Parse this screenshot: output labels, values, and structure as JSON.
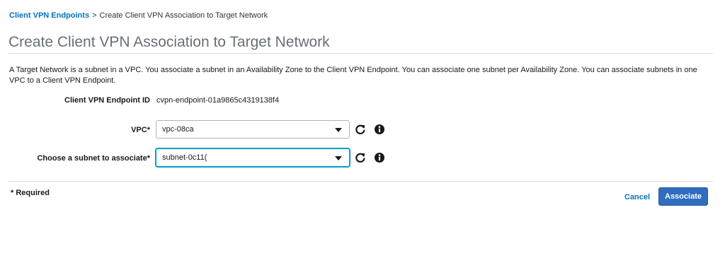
{
  "breadcrumb": {
    "parent_label": "Client VPN Endpoints",
    "separator": ">",
    "current_label": "Create Client VPN Association to Target Network"
  },
  "page": {
    "title": "Create Client VPN Association to Target Network",
    "description": "A Target Network is a subnet in a VPC. You associate a subnet in an Availability Zone to the Client VPN Endpoint. You can associate one subnet per Availability Zone. You can associate subnets in one VPC to a Client VPN Endpoint."
  },
  "form": {
    "endpoint_id": {
      "label": "Client VPN Endpoint ID",
      "value": "cvpn-endpoint-01a9865c4319138f4"
    },
    "vpc": {
      "label": "VPC*",
      "selected": "vpc-08ca"
    },
    "subnet": {
      "label": "Choose a subnet to associate*",
      "selected": "subnet-0c11("
    }
  },
  "icons": {
    "refresh": "refresh-icon",
    "info": "info-icon",
    "dropdown": "chevron-down-icon"
  },
  "footer": {
    "required_note": "* Required",
    "cancel_label": "Cancel",
    "associate_label": "Associate"
  },
  "colors": {
    "link": "#0073bb",
    "primary_button": "#2f6ebf",
    "title": "#687078",
    "focus_border": "#00a1c9"
  }
}
